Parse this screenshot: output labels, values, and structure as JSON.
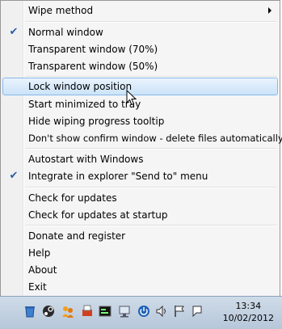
{
  "menu": {
    "items": [
      {
        "label": "Wipe method",
        "checked": false,
        "submenu": true
      },
      {
        "label": "Normal window",
        "checked": true
      },
      {
        "label": "Transparent window (70%)",
        "checked": false
      },
      {
        "label": "Transparent window (50%)",
        "checked": false
      },
      {
        "label": "Lock window position",
        "checked": false,
        "highlighted": true
      },
      {
        "label": "Start minimized to tray",
        "checked": false
      },
      {
        "label": "Hide wiping progress tooltip",
        "checked": false
      },
      {
        "label": "Don't show confirm window - delete files automatically",
        "checked": false
      },
      {
        "label": "Autostart with Windows",
        "checked": false
      },
      {
        "label": "Integrate in explorer \"Send to\" menu",
        "checked": true
      },
      {
        "label": "Check for updates",
        "checked": false
      },
      {
        "label": "Check for updates at startup",
        "checked": false
      },
      {
        "label": "Donate and register",
        "checked": false
      },
      {
        "label": "Help",
        "checked": false
      },
      {
        "label": "About",
        "checked": false
      },
      {
        "label": "Exit",
        "checked": false
      }
    ],
    "check_glyph": "✔"
  },
  "taskbar": {
    "time": "13:34",
    "date": "10/02/2012",
    "tray_icons": [
      "recycle-bin-icon",
      "steam-icon",
      "users-icon",
      "shredder-icon",
      "terminal-icon",
      "network-device-icon",
      "power-icon",
      "volume-icon",
      "flag-icon",
      "action-center-icon"
    ]
  },
  "colors": {
    "check": "#2d5ea8",
    "highlight_border": "#88b8e8",
    "taskbar": "#c4d3e3"
  }
}
